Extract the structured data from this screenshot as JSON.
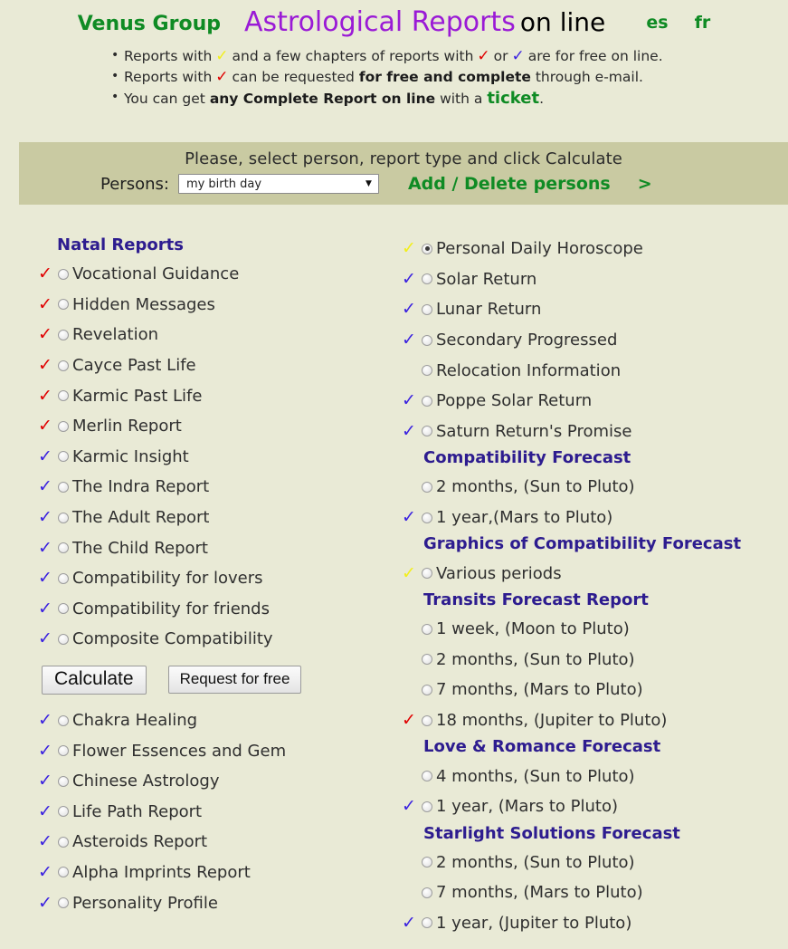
{
  "header": {
    "brand": "Venus Group",
    "title_main": "Astrological Reports",
    "title_suffix": "on line",
    "lang_es": "es",
    "lang_fr": "fr",
    "notes": {
      "line1_a": "Reports with",
      "line1_b": "and a few chapters of reports with",
      "line1_c": "or",
      "line1_d": "are for free on line.",
      "line2_a": "Reports with",
      "line2_b": "can be requested",
      "line2_bold": "for free and complete",
      "line2_c": "through e-mail.",
      "line3_a": "You can get",
      "line3_bold": "any Complete Report on line",
      "line3_b": "with a",
      "line3_ticket": "ticket",
      "line3_c": "."
    }
  },
  "selector": {
    "prompt": "Please, select person, report type and click Calculate",
    "persons_label": "Persons:",
    "persons_value": "my birth day",
    "dropdown_arrow": "▼",
    "add_delete": "Add / Delete persons",
    "next_arrow": ">"
  },
  "buttons": {
    "calculate": "Calculate",
    "request_free": "Request for free"
  },
  "colors": {
    "page_bg": "#e9ead6",
    "bar_bg": "#c9caa2",
    "brand_green": "#0f8b24",
    "title_purple": "#9a1ad6",
    "heading_indigo": "#2d1c8f",
    "check_red": "#e00000",
    "check_blue": "#3a21e0",
    "check_yellow": "#f2ef1b"
  },
  "left_column": [
    {
      "kind": "heading",
      "label": "Natal Reports"
    },
    {
      "kind": "option",
      "mark": "red",
      "label": "Vocational Guidance",
      "selected": false
    },
    {
      "kind": "option",
      "mark": "red",
      "label": "Hidden Messages",
      "selected": false
    },
    {
      "kind": "option",
      "mark": "red",
      "label": "Revelation",
      "selected": false
    },
    {
      "kind": "option",
      "mark": "red",
      "label": "Cayce Past Life",
      "selected": false
    },
    {
      "kind": "option",
      "mark": "red",
      "label": "Karmic Past Life",
      "selected": false
    },
    {
      "kind": "option",
      "mark": "red",
      "label": "Merlin Report",
      "selected": false
    },
    {
      "kind": "option",
      "mark": "blue",
      "label": "Karmic Insight",
      "selected": false
    },
    {
      "kind": "option",
      "mark": "blue",
      "label": "The Indra Report",
      "selected": false
    },
    {
      "kind": "option",
      "mark": "blue",
      "label": "The Adult Report",
      "selected": false
    },
    {
      "kind": "option",
      "mark": "blue",
      "label": "The Child Report",
      "selected": false
    },
    {
      "kind": "option",
      "mark": "blue",
      "label": "Compatibility for lovers",
      "selected": false
    },
    {
      "kind": "option",
      "mark": "blue",
      "label": "Compatibility for friends",
      "selected": false
    },
    {
      "kind": "option",
      "mark": "blue",
      "label": "Composite Compatibility",
      "selected": false
    },
    {
      "kind": "buttons"
    },
    {
      "kind": "option",
      "mark": "blue",
      "label": "Chakra Healing",
      "selected": false
    },
    {
      "kind": "option",
      "mark": "blue",
      "label": "Flower Essences and Gem",
      "selected": false
    },
    {
      "kind": "option",
      "mark": "blue",
      "label": "Chinese Astrology",
      "selected": false
    },
    {
      "kind": "option",
      "mark": "blue",
      "label": "Life Path Report",
      "selected": false
    },
    {
      "kind": "option",
      "mark": "blue",
      "label": "Asteroids Report",
      "selected": false
    },
    {
      "kind": "option",
      "mark": "blue",
      "label": "Alpha Imprints Report",
      "selected": false
    },
    {
      "kind": "option",
      "mark": "blue",
      "label": "Personality Profile",
      "selected": false
    }
  ],
  "right_column": [
    {
      "kind": "option",
      "mark": "yellow",
      "label": "Personal Daily Horoscope",
      "selected": true
    },
    {
      "kind": "option",
      "mark": "blue",
      "label": "Solar Return",
      "selected": false
    },
    {
      "kind": "option",
      "mark": "blue",
      "label": "Lunar Return",
      "selected": false
    },
    {
      "kind": "option",
      "mark": "blue",
      "label": "Secondary Progressed",
      "selected": false
    },
    {
      "kind": "option",
      "mark": "none",
      "label": "Relocation Information",
      "selected": false
    },
    {
      "kind": "option",
      "mark": "blue",
      "label": "Poppe Solar Return",
      "selected": false
    },
    {
      "kind": "option",
      "mark": "blue",
      "label": "Saturn Return's Promise",
      "selected": false
    },
    {
      "kind": "heading",
      "label": "Compatibility Forecast"
    },
    {
      "kind": "option",
      "mark": "none",
      "label": "2 months, (Sun to Pluto)",
      "selected": false
    },
    {
      "kind": "option",
      "mark": "blue",
      "label": "1 year,(Mars to Pluto)",
      "selected": false
    },
    {
      "kind": "heading",
      "label": "Graphics of Compatibility Forecast"
    },
    {
      "kind": "option",
      "mark": "yellow",
      "label": "Various periods",
      "selected": false
    },
    {
      "kind": "heading",
      "label": "Transits Forecast Report"
    },
    {
      "kind": "option",
      "mark": "none",
      "label": "1 week, (Moon to Pluto)",
      "selected": false
    },
    {
      "kind": "option",
      "mark": "none",
      "label": "2 months, (Sun to Pluto)",
      "selected": false
    },
    {
      "kind": "option",
      "mark": "none",
      "label": "7 months, (Mars to Pluto)",
      "selected": false
    },
    {
      "kind": "option",
      "mark": "red",
      "label": "18 months, (Jupiter to Pluto)",
      "selected": false
    },
    {
      "kind": "heading",
      "label": "Love & Romance Forecast"
    },
    {
      "kind": "option",
      "mark": "none",
      "label": "4 months, (Sun to Pluto)",
      "selected": false
    },
    {
      "kind": "option",
      "mark": "blue",
      "label": "1 year, (Mars to Pluto)",
      "selected": false
    },
    {
      "kind": "heading",
      "label": "Starlight Solutions Forecast"
    },
    {
      "kind": "option",
      "mark": "none",
      "label": "2 months, (Sun to Pluto)",
      "selected": false
    },
    {
      "kind": "option",
      "mark": "none",
      "label": "7 months, (Mars to Pluto)",
      "selected": false
    },
    {
      "kind": "option",
      "mark": "blue",
      "label": "1 year, (Jupiter to Pluto)",
      "selected": false
    }
  ]
}
